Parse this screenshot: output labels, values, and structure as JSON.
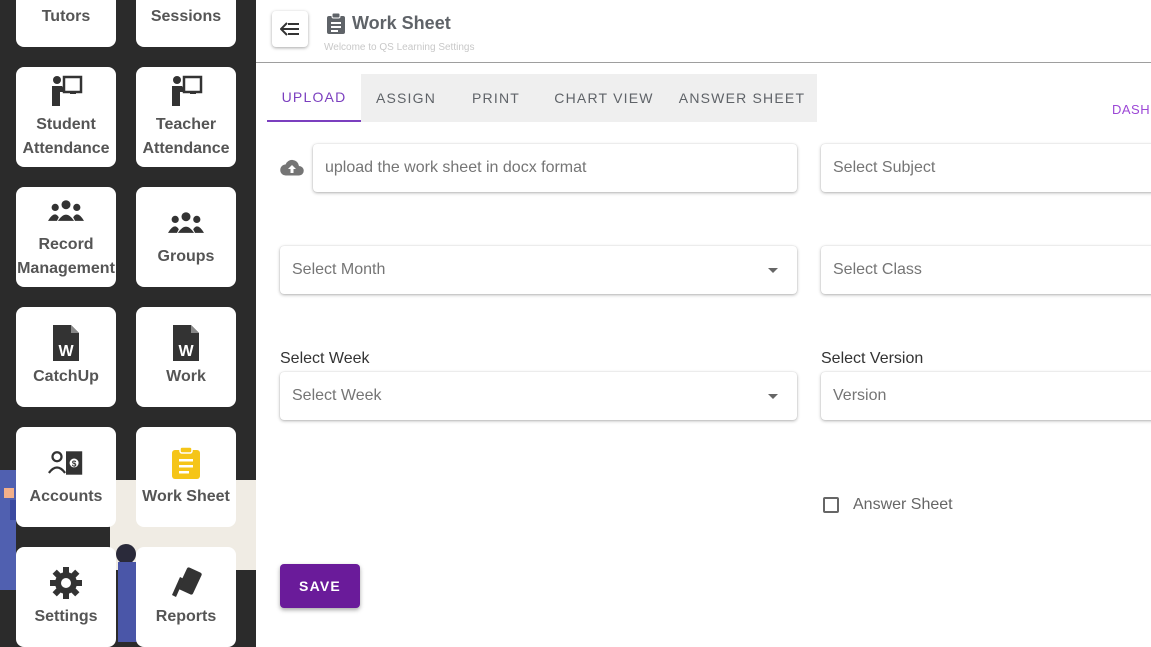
{
  "sidebar": {
    "tiles": [
      {
        "label": "Tutors",
        "icon": "tutors-icon"
      },
      {
        "label": "Sessions",
        "icon": "sessions-icon"
      },
      {
        "label": "Student Attendance",
        "icon": "student-attendance-icon"
      },
      {
        "label": "Teacher Attendance",
        "icon": "teacher-attendance-icon"
      },
      {
        "label": "Record Management",
        "icon": "record-management-icon"
      },
      {
        "label": "Groups",
        "icon": "groups-icon"
      },
      {
        "label": "CatchUp",
        "icon": "catchup-icon"
      },
      {
        "label": "Work",
        "icon": "work-icon"
      },
      {
        "label": "Accounts",
        "icon": "accounts-icon"
      },
      {
        "label": "Work Sheet",
        "icon": "work-sheet-icon"
      },
      {
        "label": "Settings",
        "icon": "settings-icon"
      },
      {
        "label": "Reports",
        "icon": "reports-icon"
      }
    ],
    "active_icon_color": "#f5c518"
  },
  "header": {
    "title": "Work Sheet",
    "subtitle": "Welcome to QS Learning Settings",
    "back_icon": "back-arrow-icon",
    "title_icon": "clipboard-icon"
  },
  "tabs": [
    {
      "label": "UPLOAD",
      "active": true
    },
    {
      "label": "ASSIGN",
      "active": false
    },
    {
      "label": "PRINT",
      "active": false
    },
    {
      "label": "CHART VIEW",
      "active": false
    },
    {
      "label": "ANSWER SHEET",
      "active": false
    }
  ],
  "dashboard_link": "DASHBOARD",
  "form": {
    "upload_placeholder": "upload the work sheet in docx format",
    "subject_placeholder": "Select Subject",
    "month_placeholder": "Select Month",
    "class_placeholder": "Select Class",
    "week_label": "Select Week",
    "week_placeholder": "Select Week",
    "version_label": "Select Version",
    "version_placeholder": "Version",
    "answer_sheet_label": "Answer Sheet",
    "answer_sheet_checked": false,
    "save_label": "SAVE"
  },
  "colors": {
    "accent": "#7b3fbf",
    "save_button": "#6a1b9a",
    "sidebar_bg": "#2b2b2b"
  }
}
